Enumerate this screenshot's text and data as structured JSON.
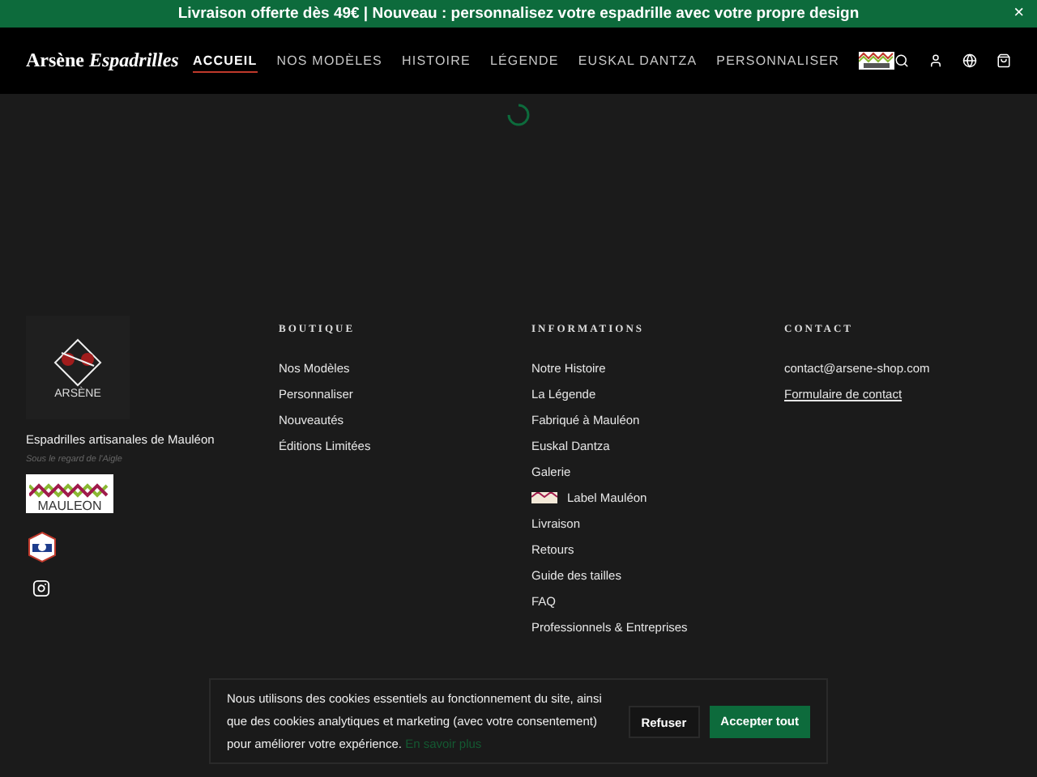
{
  "announcement": {
    "text": "Livraison offerte dès 49€ | Nouveau : personnalisez votre espadrille avec votre propre design",
    "close": "×"
  },
  "header": {
    "brand": "Arsène",
    "brand_italic": "Espadrilles",
    "nav": [
      {
        "label": "ACCUEIL",
        "selected": true
      },
      {
        "label": "NOS MODÈLES",
        "selected": false
      },
      {
        "label": "HISTOIRE",
        "selected": false
      },
      {
        "label": "LÉGENDE",
        "selected": false
      },
      {
        "label": "EUSKAL DANTZA",
        "selected": false
      },
      {
        "label": "PERSONNALISER",
        "selected": false
      }
    ]
  },
  "footer": {
    "logo_text": "ARSÈNE",
    "tagline": "Espadrilles artisanales de Mauléon",
    "subtagline": "Sous le regard de l'Aigle",
    "mauleon_label": "MAULEON",
    "columns": [
      {
        "title": "BOUTIQUE",
        "links": [
          {
            "label": "Nos Modèles"
          },
          {
            "label": "Personnaliser"
          },
          {
            "label": "Nouveautés"
          },
          {
            "label": "Éditions Limitées"
          }
        ]
      },
      {
        "title": "INFORMATIONS",
        "links": [
          {
            "label": "Notre Histoire"
          },
          {
            "label": "La Légende"
          },
          {
            "label": "Fabriqué à Mauléon"
          },
          {
            "label": "Euskal Dantza"
          },
          {
            "label": "Galerie"
          },
          {
            "label": "Label Mauléon",
            "kind": "badge"
          },
          {
            "label": "Livraison"
          },
          {
            "label": "Retours"
          },
          {
            "label": "Guide des tailles"
          },
          {
            "label": "FAQ"
          },
          {
            "label": "Professionnels & Entreprises"
          }
        ]
      },
      {
        "title": "CONTACT",
        "links": [
          {
            "label": "contact@arsene-shop.com"
          },
          {
            "label": "Formulaire de contact",
            "kind": "underlined"
          }
        ]
      }
    ]
  },
  "cookie_banner": {
    "text": "Nous utilisons des cookies essentiels au fonctionnement du site, ainsi que des cookies analytiques et marketing (avec votre consentement) pour améliorer votre expérience.",
    "link": "En savoir plus",
    "buttons": [
      {
        "label": "Refuser",
        "kind": "secondary"
      },
      {
        "label": "Accepter tout",
        "kind": "primary"
      }
    ]
  }
}
